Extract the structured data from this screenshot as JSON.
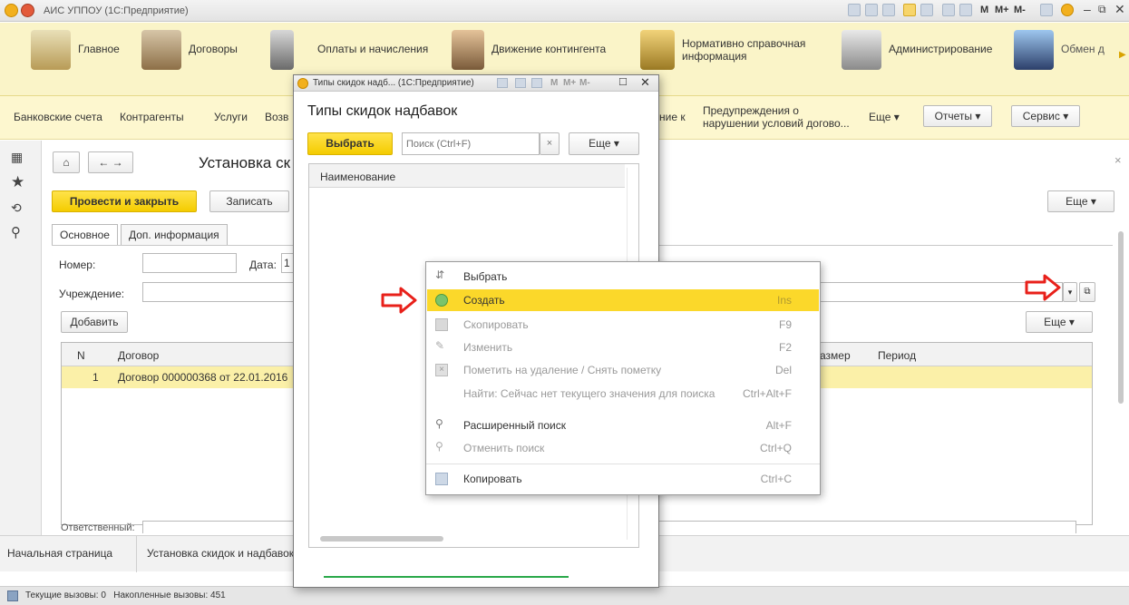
{
  "window": {
    "title": "АИС УППОУ (1С:Предприятие)",
    "toolbar_labels": [
      "M",
      "M+",
      "M-"
    ]
  },
  "sections": [
    {
      "label": "Главное",
      "icon": "home-desk-icon"
    },
    {
      "label": "Договоры",
      "icon": "handshake-icon"
    },
    {
      "label": "Оплаты и начисления",
      "icon": "abacus-icon"
    },
    {
      "label": "Движение контингента",
      "icon": "person-icon"
    },
    {
      "label": "Нормативно справочная информация",
      "icon": "books-icon"
    },
    {
      "label": "Администрирование",
      "icon": "tools-icon"
    },
    {
      "label": "Обмен д",
      "icon": "exchange-icon"
    }
  ],
  "commands": {
    "items": [
      "Банковские счета",
      "Контрагенты",
      "Услуги",
      "Возв"
    ],
    "hidden_partial": "ние к",
    "warnings": "Предупреждения о нарушении условий догово...",
    "more": "Еще",
    "reports": "Отчеты",
    "service": "Сервис"
  },
  "form": {
    "title": "Установка ск",
    "post_close": "Провести и закрыть",
    "save": "Записать",
    "more": "Еще",
    "tabs": [
      "Основное",
      "Доп. информация"
    ],
    "number_label": "Номер:",
    "date_label": "Дата:",
    "date_value": "1",
    "institution_label": "Учреждение:",
    "add_button": "Добавить",
    "table_more": "Еще",
    "columns": [
      "N",
      "Договор",
      "азмер",
      "Период"
    ],
    "rows": [
      {
        "n": "1",
        "contract": "Договор 000000368 от 22.01.2016"
      }
    ],
    "responsible_label": "Ответственный:"
  },
  "bottom": {
    "start_page": "Начальная страница",
    "open_form": "Установка скидок и надбавок"
  },
  "status": {
    "text": "Текущие вызовы: 0   Накопленные вызовы: 451"
  },
  "dialog": {
    "window_title": "Типы скидок надб... (1С:Предприятие)",
    "heading": "Типы скидок надбавок",
    "select_button": "Выбрать",
    "search_placeholder": "Поиск (Ctrl+F)",
    "clear": "×",
    "more": "Еще",
    "column": "Наименование",
    "mem_labels": [
      "M",
      "M+",
      "M-"
    ]
  },
  "context_menu": {
    "items": [
      {
        "label": "Выбрать",
        "shortcut": "",
        "icon": "select-icon",
        "disabled": false
      },
      {
        "label": "Создать",
        "shortcut": "Ins",
        "icon": "create-icon",
        "disabled": false,
        "highlighted": true
      },
      {
        "label": "Скопировать",
        "shortcut": "F9",
        "icon": "copy-item-icon",
        "disabled": true
      },
      {
        "label": "Изменить",
        "shortcut": "F2",
        "icon": "pencil-icon",
        "disabled": true
      },
      {
        "label": "Пометить на удаление / Снять пометку",
        "shortcut": "Del",
        "icon": "delete-mark-icon",
        "disabled": true
      },
      {
        "label": "Найти: Сейчас нет текущего значения для поиска",
        "shortcut": "Ctrl+Alt+F",
        "icon": "",
        "disabled": true
      },
      {
        "label": "Расширенный поиск",
        "shortcut": "Alt+F",
        "icon": "magnifier-icon",
        "disabled": false
      },
      {
        "label": "Отменить поиск",
        "shortcut": "Ctrl+Q",
        "icon": "cancel-search-icon",
        "disabled": true
      },
      {
        "label": "Копировать",
        "shortcut": "Ctrl+C",
        "icon": "clipboard-icon",
        "disabled": false
      }
    ]
  },
  "colors": {
    "accent_yellow": "#f4cc00",
    "highlight": "#fbd82a",
    "arrow_red": "#e8201a",
    "sections_bg": "#faf4c8"
  }
}
